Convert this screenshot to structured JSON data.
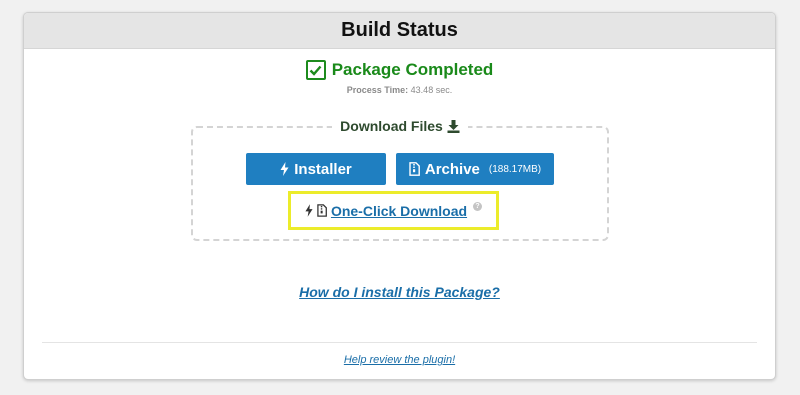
{
  "header": {
    "title": "Build Status"
  },
  "status": {
    "text": "Package Completed",
    "process_time_label": "Process Time:",
    "process_time_value": "43.48 sec."
  },
  "downloads": {
    "legend": "Download Files",
    "installer_label": "Installer",
    "archive_label": "Archive",
    "archive_size": "(188.17MB)",
    "one_click_label": "One-Click Download",
    "help_glyph": "?"
  },
  "links": {
    "install_help": "How do I install this Package?",
    "review": "Help review the plugin!"
  },
  "colors": {
    "success": "#1a8a1a",
    "primary": "#1f7fc1",
    "link": "#1a6ea8",
    "highlight": "#ecec2a"
  }
}
